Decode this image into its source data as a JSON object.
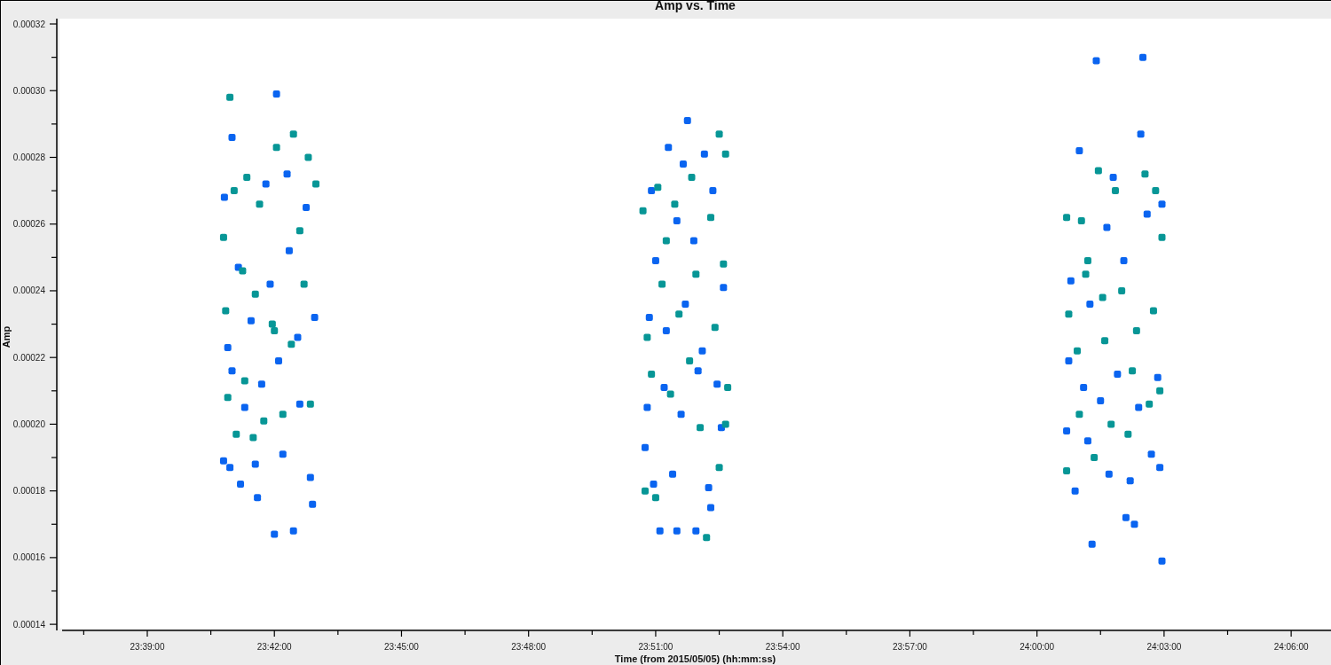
{
  "plot": {
    "chart_data": {
      "type": "scatter",
      "title": "Amp vs. Time",
      "xlabel": "Time (from 2015/05/05) (hh:mm:ss)",
      "ylabel": "Amp",
      "xlim": [
        85015.6,
        86816.4
      ],
      "ylim": [
        0.0001387,
        0.0003216
      ],
      "xticks": [
        {
          "value": 85140,
          "label": "23:39:00"
        },
        {
          "value": 85320,
          "label": "23:42:00"
        },
        {
          "value": 85500,
          "label": "23:45:00"
        },
        {
          "value": 85680,
          "label": "23:48:00"
        },
        {
          "value": 85860,
          "label": "23:51:00"
        },
        {
          "value": 86040,
          "label": "23:54:00"
        },
        {
          "value": 86220,
          "label": "23:57:00"
        },
        {
          "value": 86400,
          "label": "24:00:00"
        },
        {
          "value": 86580,
          "label": "24:03:00"
        },
        {
          "value": 86760,
          "label": "24:06:00"
        }
      ],
      "yticks": [
        {
          "value": 0.00014,
          "label": "0.00014"
        },
        {
          "value": 0.00016,
          "label": "0.00016"
        },
        {
          "value": 0.00018,
          "label": "0.00018"
        },
        {
          "value": 0.0002,
          "label": "0.00020"
        },
        {
          "value": 0.00022,
          "label": "0.00022"
        },
        {
          "value": 0.00024,
          "label": "0.00024"
        },
        {
          "value": 0.00026,
          "label": "0.00026"
        },
        {
          "value": 0.00028,
          "label": "0.00028"
        },
        {
          "value": 0.0003,
          "label": "0.00030"
        },
        {
          "value": 0.00032,
          "label": "0.00032"
        }
      ],
      "series": [
        {
          "color": "#0a64f0",
          "x": [
            85249.2,
            85260,
            85323,
            85296,
            85320,
            85347,
            85374,
            85248,
            85257,
            85272,
            85293,
            85332,
            85371,
            85278,
            85302,
            85326,
            85356,
            85254,
            85287,
            85314,
            85341,
            85365,
            85269,
            85377,
            85308,
            85338,
            85260,
            85353,
            85905,
            85878,
            85866,
            85890,
            85938,
            85917,
            85845,
            85857,
            85884,
            85935,
            85953,
            85848,
            85872,
            85896,
            85920,
            85947,
            85851,
            85875,
            85902,
            85926,
            85956,
            85860,
            85890,
            85914,
            85941,
            85854,
            85899,
            85929,
            86484,
            86550,
            86547,
            86460,
            86478,
            86577,
            86526,
            86538,
            86442,
            86454,
            86472,
            86502,
            86532,
            86562,
            86574,
            86445,
            86466,
            86490,
            86514,
            86544,
            86571,
            86448,
            86475,
            86499,
            86523,
            86556,
            86577,
            86508
          ],
          "values": [
            0.000268,
            0.000286,
            0.000299,
            0.000178,
            0.000167,
            0.000168,
            0.000176,
            0.000189,
            0.000187,
            0.000182,
            0.000188,
            0.000191,
            0.000184,
            0.000205,
            0.000212,
            0.000219,
            0.000206,
            0.000223,
            0.000231,
            0.000242,
            0.000252,
            0.000265,
            0.000247,
            0.000232,
            0.000272,
            0.000275,
            0.000216,
            0.000226,
            0.000291,
            0.000283,
            0.000168,
            0.000168,
            0.000175,
            0.000168,
            0.000193,
            0.000182,
            0.000185,
            0.000181,
            0.000199,
            0.000205,
            0.000211,
            0.000203,
            0.000216,
            0.000212,
            0.000232,
            0.000228,
            0.000236,
            0.000222,
            0.000241,
            0.000249,
            0.000261,
            0.000255,
            0.00027,
            0.00027,
            0.000278,
            0.000281,
            0.000309,
            0.00031,
            0.000287,
            0.000282,
            0.000164,
            0.000159,
            0.000172,
            0.00017,
            0.000198,
            0.00018,
            0.000195,
            0.000185,
            0.000183,
            0.000191,
            0.000187,
            0.000219,
            0.000211,
            0.000207,
            0.000215,
            0.000205,
            0.000214,
            0.000243,
            0.000236,
            0.000259,
            0.000249,
            0.000263,
            0.000266,
            0.000274
          ]
        },
        {
          "color": "#079696",
          "x": [
            85257,
            85347,
            85248,
            85263,
            85281,
            85299,
            85323,
            85368,
            85378.8,
            85251,
            85275,
            85293,
            85317,
            85344,
            85362,
            85254,
            85278,
            85305,
            85332,
            85371,
            85266,
            85290,
            85320,
            85356,
            85950,
            85932,
            85842,
            85863,
            85887,
            85911,
            85959,
            85848,
            85869,
            85893,
            85917,
            85944,
            85956,
            85845,
            85860,
            85881,
            85908,
            85923,
            85950,
            85962,
            85875,
            85938,
            85854,
            85959,
            86442,
            86463,
            86487,
            86511,
            86553,
            86568,
            86445,
            86469,
            86493,
            86520,
            86541,
            86577,
            86442,
            86460,
            86481,
            86505,
            86529,
            86559,
            86574,
            86457,
            86496,
            86535,
            86565,
            86472
          ],
          "values": [
            0.000298,
            0.000287,
            0.000256,
            0.00027,
            0.000274,
            0.000266,
            0.000283,
            0.00028,
            0.000272,
            0.000234,
            0.000246,
            0.000239,
            0.00023,
            0.000224,
            0.000242,
            0.000208,
            0.000213,
            0.000201,
            0.000203,
            0.000206,
            0.000197,
            0.000196,
            0.000228,
            0.000258,
            0.000287,
            0.000166,
            0.000264,
            0.000271,
            0.000266,
            0.000274,
            0.000281,
            0.000226,
            0.000242,
            0.000233,
            0.000245,
            0.000229,
            0.000248,
            0.00018,
            0.000178,
            0.000209,
            0.000219,
            0.000199,
            0.000187,
            0.000211,
            0.000255,
            0.000262,
            0.000215,
            0.0002,
            0.000262,
            0.000261,
            0.000276,
            0.00027,
            0.000275,
            0.00027,
            0.000233,
            0.000245,
            0.000238,
            0.00024,
            0.000228,
            0.000256,
            0.000186,
            0.000203,
            0.00019,
            0.0002,
            0.000197,
            0.000206,
            0.00021,
            0.000222,
            0.000225,
            0.000216,
            0.000234,
            0.000249
          ]
        }
      ]
    }
  }
}
